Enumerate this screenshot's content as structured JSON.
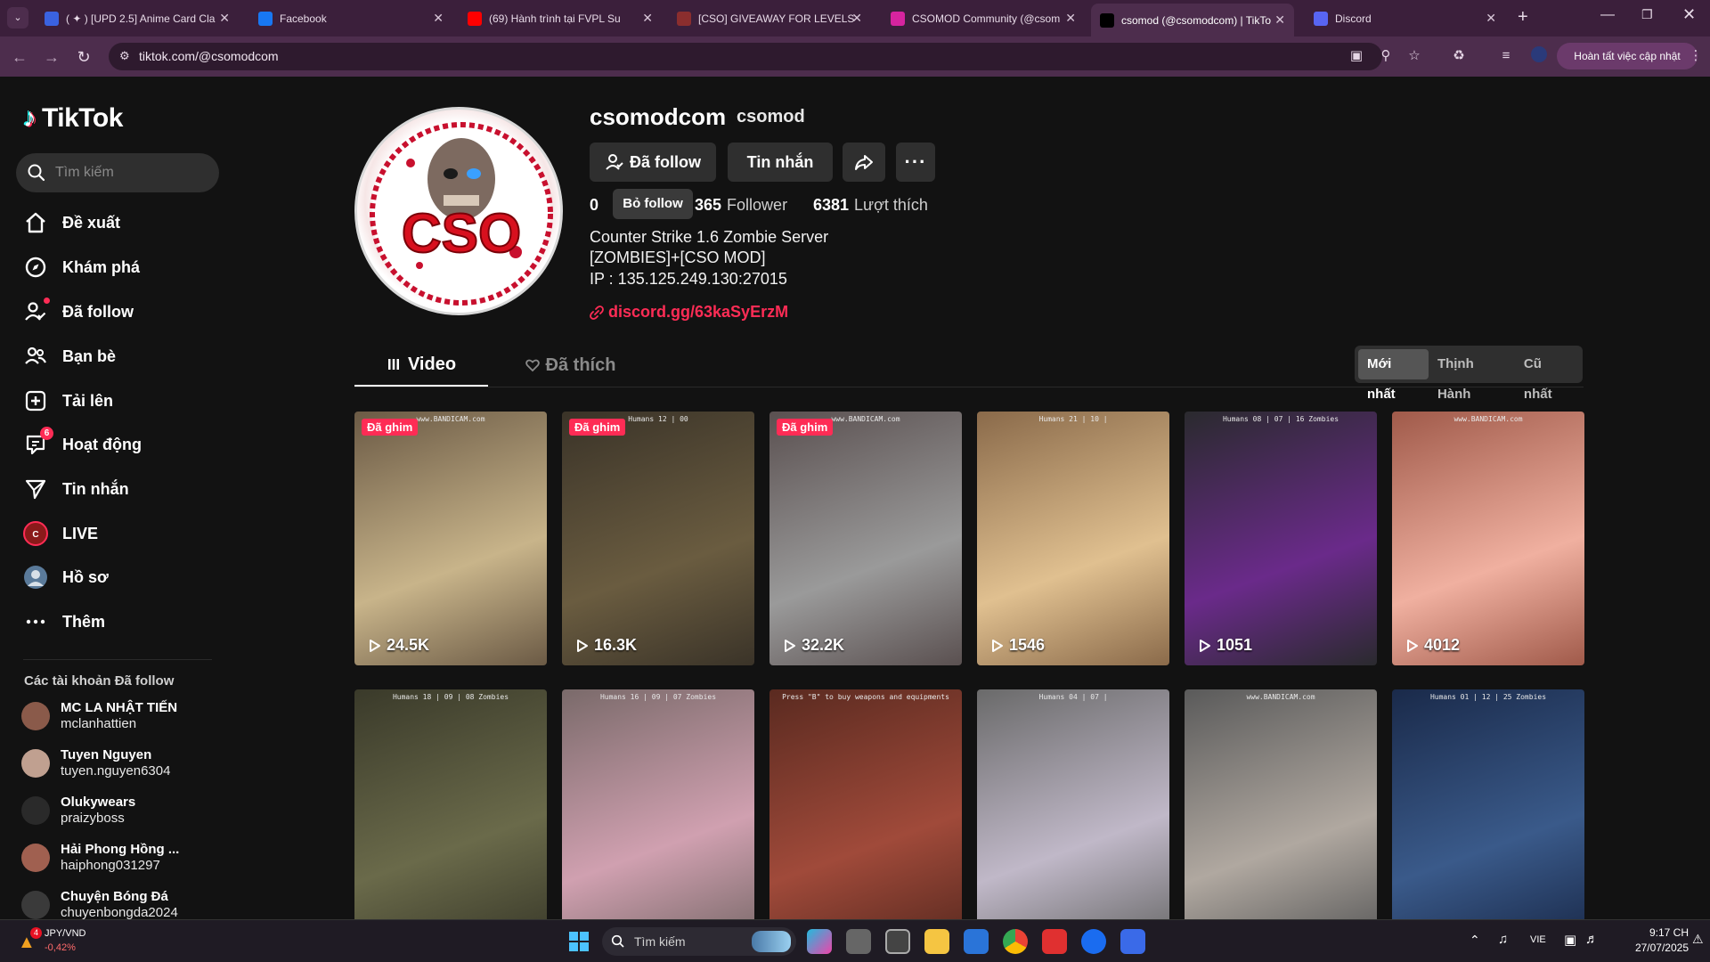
{
  "browser": {
    "tabs": [
      {
        "title": "( ✦ ) [UPD 2.5] Anime Card Cla",
        "color": "#3a62e0"
      },
      {
        "title": "Facebook",
        "color": "#1877f2"
      },
      {
        "title": "(69) Hành trình tại FVPL Su",
        "color": "#ff0000"
      },
      {
        "title": "[CSO] GIVEAWAY FOR LEVELS",
        "color": "#8b2e2e"
      },
      {
        "title": "CSOMOD Community (@csom",
        "color": "#d6249f"
      },
      {
        "title": "csomod (@csomodcom) | TikTo",
        "color": "#000000"
      },
      {
        "title": "Discord",
        "color": "#5865f2"
      }
    ],
    "url": "tiktok.com/@csomodcom",
    "update_button": "Hoàn tất việc cập nhật"
  },
  "sidebar": {
    "logo": "TikTok",
    "search_placeholder": "Tìm kiếm",
    "items": [
      {
        "label": "Đề xuất",
        "icon": "home-icon"
      },
      {
        "label": "Khám phá",
        "icon": "compass-icon"
      },
      {
        "label": "Đã follow",
        "icon": "following-icon"
      },
      {
        "label": "Bạn bè",
        "icon": "friends-icon"
      },
      {
        "label": "Tải lên",
        "icon": "upload-icon"
      },
      {
        "label": "Hoạt động",
        "icon": "activity-icon",
        "badge": "6"
      },
      {
        "label": "Tin nhắn",
        "icon": "messages-icon"
      },
      {
        "label": "LIVE",
        "icon": "live-icon"
      },
      {
        "label": "Hồ sơ",
        "icon": "profile-icon"
      },
      {
        "label": "Thêm",
        "icon": "more-icon"
      }
    ],
    "following_title": "Các tài khoản Đã follow",
    "following": [
      {
        "name": "MC LA NHẬT TIẾN",
        "handle": "mclanhattien"
      },
      {
        "name": "Tuyen Nguyen",
        "handle": "tuyen.nguyen6304"
      },
      {
        "name": "Olukywears",
        "handle": "praizyboss"
      },
      {
        "name": "Hải Phong Hồng ...",
        "handle": "haiphong031297"
      },
      {
        "name": "Chuyện Bóng Đá",
        "handle": "chuyenbongda2024"
      }
    ]
  },
  "profile": {
    "username": "csomodcom",
    "nickname": "csomod",
    "follow_button": "Đã follow",
    "message_button": "Tin nhắn",
    "stats": {
      "following_count": "0",
      "follower_count": "365",
      "follower_label": "Follower",
      "likes_count": "6381",
      "likes_label": "Lượt thích"
    },
    "tooltip": "Bỏ follow",
    "bio": [
      "Counter Strike 1.6 Zombie Server",
      "[ZOMBIES]+[CSO MOD]",
      "IP : 135.125.249.130:27015"
    ],
    "link": "discord.gg/63kaSyErzM",
    "avatar_text": "CSO"
  },
  "tabs": {
    "videos": "Video",
    "liked": "Đã thích"
  },
  "sort": {
    "latest": "Mới nhất",
    "popular": "Thịnh Hành",
    "oldest": "Cũ nhất"
  },
  "videos": [
    {
      "views": "24.5K",
      "pinned": "Đã ghim",
      "hud": "www.BANDICAM.com",
      "bg": [
        "#6b5a45",
        "#c8b48a"
      ]
    },
    {
      "views": "16.3K",
      "pinned": "Đã ghim",
      "hud": "Humans 12 | 00",
      "bg": [
        "#3a3328",
        "#6a5c40"
      ]
    },
    {
      "views": "32.2K",
      "pinned": "Đã ghim",
      "hud": "www.BANDICAM.com",
      "bg": [
        "#5a5050",
        "#9a9a9a"
      ]
    },
    {
      "views": "1546",
      "pinned": "",
      "hud": "Humans 21 | 10 |",
      "bg": [
        "#8a6a4a",
        "#e0c090"
      ]
    },
    {
      "views": "1051",
      "pinned": "",
      "hud": "Humans 08 | 07 | 16 Zombies",
      "bg": [
        "#2a2a2e",
        "#6a2a8a"
      ]
    },
    {
      "views": "4012",
      "pinned": "",
      "hud": "www.BANDICAM.com",
      "bg": [
        "#a05a4a",
        "#f0b0a0"
      ]
    },
    {
      "views": "",
      "pinned": "",
      "hud": "Humans 18 | 09 | 08 Zombies",
      "bg": [
        "#3a3a2a",
        "#6a6a4a"
      ]
    },
    {
      "views": "",
      "pinned": "",
      "hud": "Humans 16 | 09 | 07 Zombies",
      "bg": [
        "#7a6a6a",
        "#d0a0b0"
      ]
    },
    {
      "views": "",
      "pinned": "",
      "hud": "Press \"B\" to buy weapons and equipments",
      "bg": [
        "#5a2a20",
        "#a04a3a"
      ]
    },
    {
      "views": "",
      "pinned": "",
      "hud": "Humans 04 | 07 |",
      "bg": [
        "#6a6a6a",
        "#c0b8c8"
      ]
    },
    {
      "views": "",
      "pinned": "",
      "hud": "www.BANDICAM.com",
      "bg": [
        "#5a5a5a",
        "#b0a8a0"
      ]
    },
    {
      "views": "",
      "pinned": "",
      "hud": "Humans 01 | 12 | 25 Zombies",
      "bg": [
        "#1a2a4a",
        "#3a5a8a"
      ]
    }
  ],
  "taskbar": {
    "widget_title": "JPY/VND",
    "widget_value": "-0,42%",
    "widget_badge": "4",
    "search": "Tìm kiếm",
    "lang": "VIE",
    "time": "9:17 CH",
    "date": "27/07/2025"
  },
  "colors": {
    "accent": "#fe2c55",
    "browser_frame": "#3b1f3b"
  }
}
